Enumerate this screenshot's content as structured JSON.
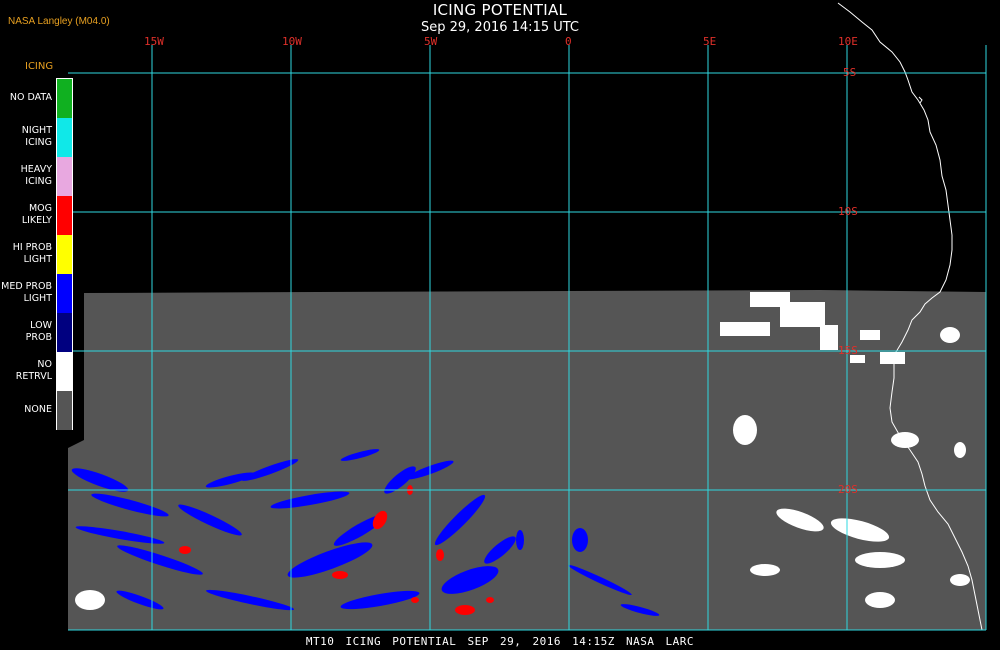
{
  "header": {
    "credit": "NASA Langley (M04.0)",
    "title": "ICING POTENTIAL",
    "subtitle": "Sep 29, 2016 14:15 UTC"
  },
  "map": {
    "background": "#000000",
    "land_sea_data_color": "#555555",
    "grid_color": "#2fd8e0",
    "label_color": "#e0302a",
    "coastline_color": "#ffffff",
    "lon_labels": [
      "15W",
      "10W",
      "5W",
      "0",
      "5E",
      "10E"
    ],
    "lat_labels": [
      "5S",
      "10S",
      "15S",
      "20S"
    ]
  },
  "legend": {
    "title": "ICING",
    "items": [
      {
        "label": "NO DATA",
        "color": "#10b020"
      },
      {
        "label": "NIGHT\nICING",
        "color": "#10e8e8"
      },
      {
        "label": "HEAVY\nICING",
        "color": "#e8a8e0"
      },
      {
        "label": "MOG\nLIKELY",
        "color": "#ff0000"
      },
      {
        "label": "HI PROB\nLIGHT",
        "color": "#ffff00"
      },
      {
        "label": "MED PROB\nLIGHT",
        "color": "#0000ff"
      },
      {
        "label": "LOW\nPROB",
        "color": "#000080"
      },
      {
        "label": "NO\nRETRVL",
        "color": "#ffffff"
      },
      {
        "label": "NONE",
        "color": "#555555"
      }
    ]
  },
  "footer": {
    "text": "MT10  ICING POTENTIAL   SEP 29, 2016 14:15Z   NASA LARC"
  }
}
